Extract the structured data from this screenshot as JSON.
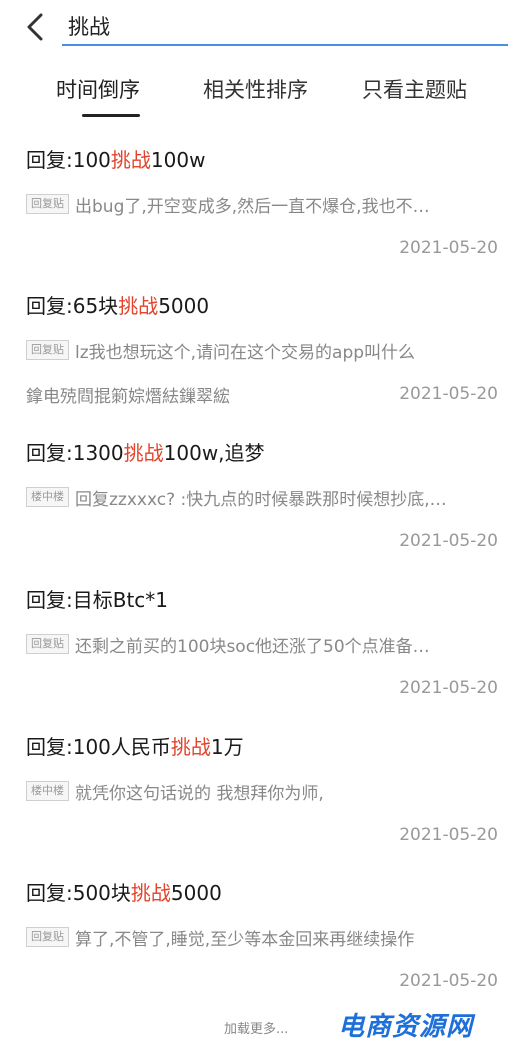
{
  "header": {
    "back_label": "‹",
    "search_value": "挑战"
  },
  "tabs": [
    {
      "label": "时间倒序",
      "active": true
    },
    {
      "label": "相关性排序",
      "active": false
    },
    {
      "label": "只看主题贴",
      "active": false
    }
  ],
  "posts": [
    {
      "title_pre": "回复:100",
      "title_hl": "挑战",
      "title_post": "100w",
      "tag": "回复贴",
      "snippet": "出bug了,开空变成多,然后一直不爆仓,我也不…",
      "extra": "",
      "date": "2021-05-20"
    },
    {
      "title_pre": "回复:65块",
      "title_hl": "挑战",
      "title_post": "5000",
      "tag": "回复贴",
      "snippet": "lz我也想玩这个,请问在这个交易的app叫什么",
      "extra": "鎿电殑閰掍箣婃熸紶鏁翠綋",
      "date": "2021-05-20"
    },
    {
      "title_pre": "回复:1300",
      "title_hl": "挑战",
      "title_post": "100w,追梦",
      "tag": "楼中楼",
      "snippet": "回复zzxxxc? :快九点的时候暴跌那时候想抄底,…",
      "extra": "",
      "date": "2021-05-20"
    },
    {
      "title_pre": "回复:目标Btc*1",
      "title_hl": "",
      "title_post": "",
      "tag": "回复贴",
      "snippet": "还剩之前买的100块soc他还涨了50个点准备…",
      "extra": "",
      "date": "2021-05-20"
    },
    {
      "title_pre": "回复:100人民币",
      "title_hl": "挑战",
      "title_post": "1万",
      "tag": "楼中楼",
      "snippet": "就凭你这句话说的 我想拜你为师,",
      "extra": "",
      "date": "2021-05-20"
    },
    {
      "title_pre": "回复:500块",
      "title_hl": "挑战",
      "title_post": "5000",
      "tag": "回复贴",
      "snippet": "算了,不管了,睡觉,至少等本金回来再继续操作",
      "extra": "",
      "date": "2021-05-20"
    }
  ],
  "footer": {
    "load_more": "加载更多...",
    "watermark": "电商资源网"
  },
  "colors": {
    "highlight": "#e2442b",
    "search_underline": "#4a90e2",
    "watermark": "#1e6fd9"
  }
}
